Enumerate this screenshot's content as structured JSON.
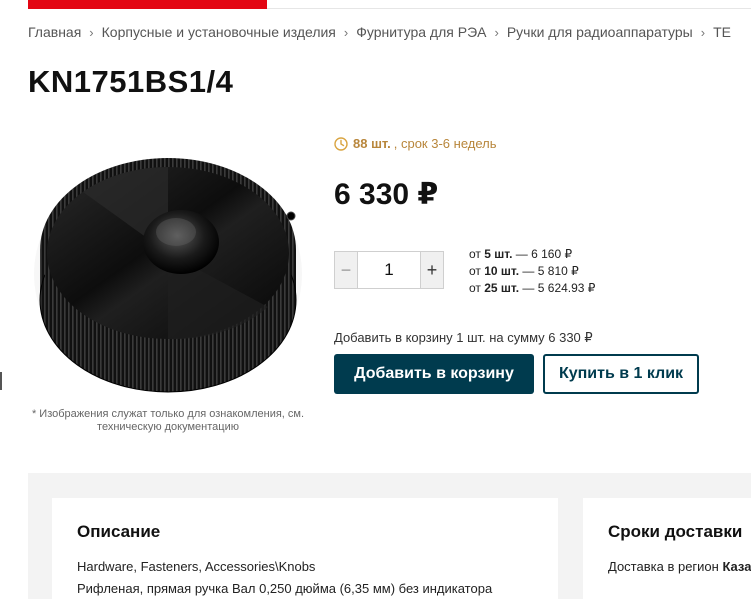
{
  "breadcrumb": {
    "items": [
      "Главная",
      "Корпусные и установочные изделия",
      "Фурнитура для РЭА",
      "Ручки для радиоаппаратуры",
      "TE"
    ],
    "separator": "›"
  },
  "product": {
    "title": "KN1751BS1/4",
    "image_alt": "Black knurled control knob",
    "image_disclaimer": "* Изображения служат только для ознакомления, см. техническую документацию"
  },
  "availability": {
    "icon": "clock-icon",
    "stock": "88 шт.",
    "lead_time": ", срок 3-6 недель",
    "color": "#b8863b"
  },
  "price": {
    "current": "6 330 ₽"
  },
  "quantity": {
    "value": "1",
    "minus_label": "−",
    "plus_label": "+"
  },
  "price_tiers": [
    {
      "prefix": "от ",
      "qty": "5 шт.",
      "price": " — 6 160 ₽"
    },
    {
      "prefix": "от ",
      "qty": "10 шт.",
      "price": " — 5 810 ₽"
    },
    {
      "prefix": "от ",
      "qty": "25 шт.",
      "price": " — 5 624.93 ₽"
    }
  ],
  "cart": {
    "summary": "Добавить в корзину 1 шт. на сумму 6 330 ₽",
    "add_button": "Добавить в корзину",
    "buy_one_click": "Купить в 1 клик"
  },
  "description": {
    "heading": "Описание",
    "category_path": "Hardware, Fasteners, Accessories\\Knobs",
    "text": "Рифленая, прямая ручка Вал 0,250 дюйма (6,35 мм) без индикатора"
  },
  "delivery": {
    "heading": "Сроки доставки",
    "region_label": "Доставка в регион ",
    "region_value": "Каза"
  },
  "colors": {
    "accent_red": "#e30613",
    "primary_button": "#003b4e",
    "section_bg": "#f3f3f3"
  }
}
